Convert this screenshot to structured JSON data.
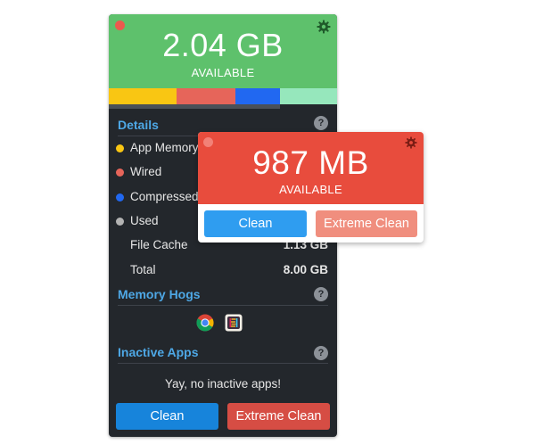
{
  "main": {
    "available_value": "2.04 GB",
    "available_label": "AVAILABLE",
    "memory_bar": [
      {
        "name": "app-memory",
        "color": "#f9c613",
        "fraction": 0.297
      },
      {
        "name": "wired",
        "color": "#e6655a",
        "fraction": 0.258
      },
      {
        "name": "compressed",
        "color": "#2168f1",
        "fraction": 0.195
      },
      {
        "name": "free",
        "color": "#96e7bc",
        "fraction": 0.25
      }
    ],
    "details_title": "Details",
    "details": [
      {
        "label": "App Memory",
        "value": "",
        "dot_color": "#f9c613"
      },
      {
        "label": "Wired",
        "value": "",
        "dot_color": "#e6655a"
      },
      {
        "label": "Compressed",
        "value": "",
        "dot_color": "#2168f1"
      },
      {
        "label": "Used",
        "value": "",
        "dot_color": "#b3b3b3"
      },
      {
        "label": "File Cache",
        "value": "1.13 GB",
        "dot_color": ""
      },
      {
        "label": "Total",
        "value": "8.00 GB",
        "dot_color": ""
      }
    ],
    "memory_hogs_title": "Memory Hogs",
    "inactive_apps_title": "Inactive Apps",
    "inactive_apps_message": "Yay, no inactive apps!",
    "clean_label": "Clean",
    "extreme_clean_label": "Extreme Clean",
    "help_glyph": "?"
  },
  "popup": {
    "available_value": "987 MB",
    "available_label": "AVAILABLE",
    "clean_label": "Clean",
    "extreme_clean_label": "Extreme Clean"
  },
  "icons": {
    "gear": "gear-icon",
    "chrome": "chrome-icon",
    "slack": "slack-icon"
  },
  "colors": {
    "main_header": "#5ec16c",
    "popup_header": "#e84c3d",
    "panel_bg": "#23272c",
    "accent_blue": "#4ea8e6"
  }
}
